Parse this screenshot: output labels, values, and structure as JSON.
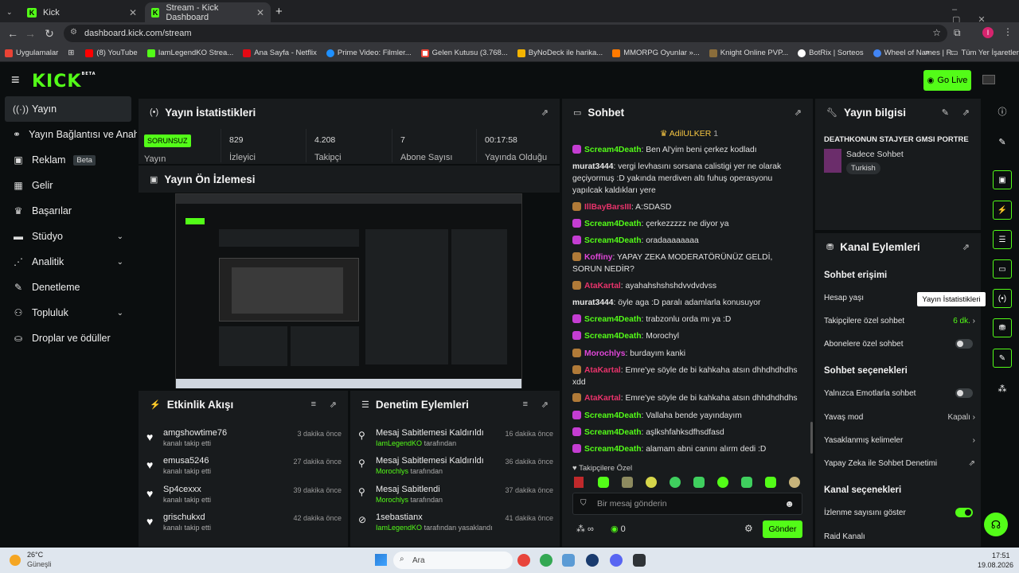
{
  "browser": {
    "tabs": [
      {
        "title": "Kick"
      },
      {
        "title": "Stream - Kick Dashboard"
      }
    ],
    "url": "dashboard.kick.com/stream",
    "bookmarks": [
      "Uygulamalar",
      "(8) YouTube",
      "IamLegendKO Strea...",
      "Ana Sayfa - Netflix",
      "Prime Video: Filmler...",
      "Gelen Kutusu (3.768...",
      "ByNoDeck ile harika...",
      "MMORPG Oyunlar »...",
      "Knight Online PVP...",
      "BotRix | Sorteos",
      "Wheel of Names | R..."
    ],
    "bookmarks_more": "»",
    "other_bookmarks": "Tüm Yer İşaretleri"
  },
  "header": {
    "logo": "KICK",
    "logo_sup": "BETA",
    "go_live": "Go Live"
  },
  "sidebar": {
    "items": [
      {
        "label": "Yayın",
        "icon": "broadcast-icon"
      },
      {
        "label": "Yayın Bağlantısı ve Anahtar",
        "icon": "link-icon"
      },
      {
        "label": "Reklam",
        "icon": "ad-icon",
        "badge": "Beta"
      },
      {
        "label": "Gelir",
        "icon": "grid-icon"
      },
      {
        "label": "Başarılar",
        "icon": "trophy-icon"
      },
      {
        "label": "Stüdyo",
        "icon": "studio-icon"
      },
      {
        "label": "Analitik",
        "icon": "analytics-icon"
      },
      {
        "label": "Denetleme",
        "icon": "wrench-icon"
      },
      {
        "label": "Topluluk",
        "icon": "community-icon"
      },
      {
        "label": "Droplar ve ödüller",
        "icon": "gift-icon"
      }
    ]
  },
  "stats": {
    "title": "Yayın İstatistikleri",
    "status": "SORUNSUZ",
    "status_label": "Yayın",
    "items": [
      {
        "value": "829",
        "label": "İzleyici"
      },
      {
        "value": "4.208",
        "label": "Takipçi"
      },
      {
        "value": "7",
        "label": "Abone Sayısı"
      },
      {
        "value": "00:17:58",
        "label": "Yayında Olduğu"
      }
    ]
  },
  "preview": {
    "title": "Yayın Ön İzlemesi"
  },
  "activity": {
    "title": "Etkinlik Akışı",
    "items": [
      {
        "name": "amgshowtime76",
        "sub": "kanalı takip etti",
        "time": "3 dakika önce"
      },
      {
        "name": "emusa5246",
        "sub": "kanalı takip etti",
        "time": "27 dakika önce"
      },
      {
        "name": "Sp4cexxx",
        "sub": "kanalı takip etti",
        "time": "39 dakika önce"
      },
      {
        "name": "grischukxd",
        "sub": "kanalı takip etti",
        "time": "42 dakika önce"
      }
    ]
  },
  "moderation": {
    "title": "Denetim Eylemleri",
    "items": [
      {
        "action": "Mesaj Sabitlemesi Kaldırıldı",
        "user": "IamLegendKO",
        "suffix": "tarafından",
        "time": "16 dakika önce"
      },
      {
        "action": "Mesaj Sabitlemesi Kaldırıldı",
        "user": "Morochlys",
        "suffix": "tarafından",
        "time": "36 dakika önce"
      },
      {
        "action": "Mesaj Sabitlendi",
        "user": "Morochlys",
        "suffix": "tarafından",
        "time": "37 dakika önce"
      },
      {
        "action": "1sebastianx",
        "user": "IamLegendKO",
        "suffix": "tarafından yasaklandı",
        "time": "41 dakika önce"
      }
    ]
  },
  "chat": {
    "title": "Sohbet",
    "pinned_user": "AdilULKER",
    "pinned_count": "1",
    "messages": [
      {
        "user": "Scream4Death",
        "color": "#53fc18",
        "text": "Ben Al'yim beni çerkez kodladı"
      },
      {
        "user": "murat3444",
        "color": "#e8e8e8",
        "text": "vergi levhasını sorsana calistigi yer ne olarak geçiyormuş :D yakında merdiven altı fuhuş operasyonu yapılcak kaldıkları yere"
      },
      {
        "user": "IllBayBarsIII",
        "color": "#e8336b",
        "text": "A:SDASD"
      },
      {
        "user": "Scream4Death",
        "color": "#53fc18",
        "text": "çerkezzzzz ne diyor ya"
      },
      {
        "user": "Scream4Death",
        "color": "#53fc18",
        "text": "oradaaaaaaaa"
      },
      {
        "user": "Koffiny",
        "color": "#e046d8",
        "text": "YAPAY ZEKA MODERATÖRÜNÜZ GELDİ, SORUN NEDİR?"
      },
      {
        "user": "AtaKartal",
        "color": "#e8336b",
        "text": "ayahahshshshdvvdvdvss"
      },
      {
        "user": "murat3444",
        "color": "#e8e8e8",
        "text": "öyle aga :D paralı adamlarla konusuyor"
      },
      {
        "user": "Scream4Death",
        "color": "#53fc18",
        "text": "trabzonlu orda mı ya :D"
      },
      {
        "user": "Scream4Death",
        "color": "#53fc18",
        "text": "Morochyl"
      },
      {
        "user": "Morochlys",
        "color": "#e046d8",
        "text": "burdayım kanki"
      },
      {
        "user": "AtaKartal",
        "color": "#e8336b",
        "text": "Emre'ye söyle de bi kahkaha atsın dhhdhdhdhs xdd"
      },
      {
        "user": "AtaKartal",
        "color": "#e8336b",
        "text": "Emre'ye söyle de bi kahkaha atsın dhhdhdhdhs"
      },
      {
        "user": "Scream4Death",
        "color": "#53fc18",
        "text": "Vallaha bende yayındayım"
      },
      {
        "user": "Scream4Death",
        "color": "#53fc18",
        "text": "aşlkshfahksdfhsdfasd"
      },
      {
        "user": "Scream4Death",
        "color": "#53fc18",
        "text": "alamam abni canını alırm dedi :D"
      }
    ],
    "followers_only": "Takipçilere Özel",
    "input_placeholder": "Bir mesaj gönderin",
    "points": "0",
    "send": "Gönder"
  },
  "info": {
    "title": "Yayın bilgisi",
    "stream_title": "DEATHKONUN STAJYER GMSI PORTRE",
    "category": "Sadece Sohbet",
    "tag": "Turkish"
  },
  "channel_actions": {
    "title": "Kanal Eylemleri",
    "chat_access": "Sohbet erişimi",
    "account_age": "Hesap yaşı",
    "followers_only": "Takipçilere özel sohbet",
    "followers_value": "6 dk.",
    "subs_only": "Abonelere özel sohbet",
    "chat_options": "Sohbet seçenekleri",
    "emotes_only": "Yalnızca Emotlarla sohbet",
    "slow_mode": "Yavaş mod",
    "slow_value": "Kapalı",
    "banned_words": "Yasaklanmış kelimeler",
    "ai_mod": "Yapay Zeka ile Sohbet Denetimi",
    "channel_options": "Kanal seçenekleri",
    "show_viewers": "İzlenme sayısını göster",
    "raid": "Raid Kanalı"
  },
  "tooltip": "Yayın İstatistikleri",
  "taskbar": {
    "weather_temp": "26°C",
    "weather_desc": "Güneşli",
    "search": "Ara",
    "time": "17:51",
    "date": "19.08.2026"
  },
  "colors": {
    "accent": "#53fc18",
    "panel": "#181b1d",
    "bg": "#0b0e0f"
  }
}
